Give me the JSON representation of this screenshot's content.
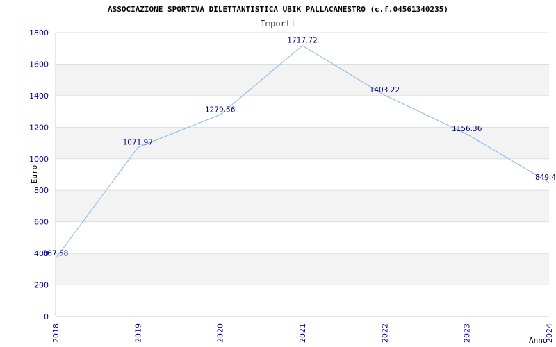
{
  "chart_data": {
    "type": "line",
    "title": "ASSOCIAZIONE SPORTIVA DILETTANTISTICA UBIK PALLACANESTRO (c.f.04561340235)",
    "subtitle": "Importi",
    "xlabel": "Anno",
    "ylabel": "Euro",
    "categories": [
      "2018",
      "2019",
      "2020",
      "2021",
      "2022",
      "2023",
      "2024"
    ],
    "series": [
      {
        "values": [
          367.58,
          1071.97,
          1279.56,
          1717.72,
          1403.22,
          1156.36,
          849.4
        ],
        "labels": [
          "367.58",
          "1071.97",
          "1279.56",
          "1717.72",
          "1403.22",
          "1156.36",
          "849.4"
        ]
      }
    ],
    "ylim": [
      0,
      1800
    ],
    "yticks": [
      "0",
      "200",
      "400",
      "600",
      "800",
      "1000",
      "1200",
      "1400",
      "1600",
      "1800"
    ],
    "grid": true,
    "colors": {
      "line": "#7fb5e8",
      "band": "#f3f3f3",
      "gridline": "#dddddd",
      "tick_text": "#0000aa",
      "data_label": "#000080"
    }
  }
}
